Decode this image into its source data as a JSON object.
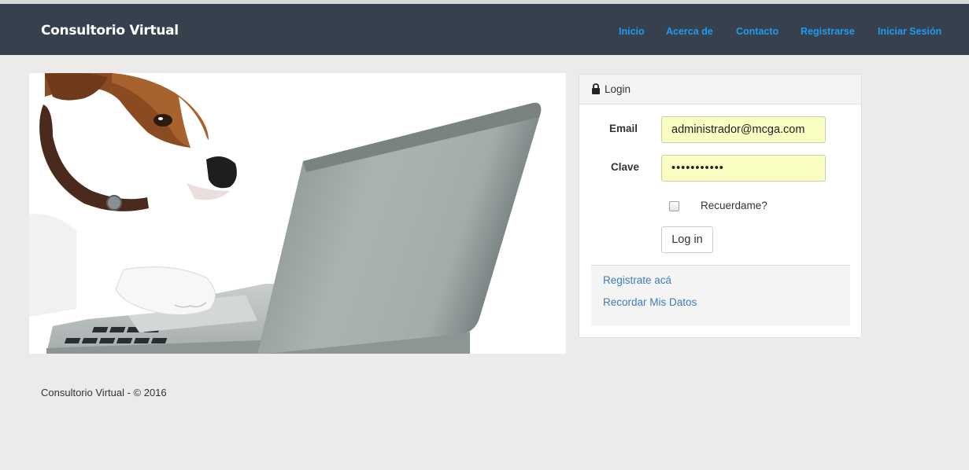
{
  "brand": "Consultorio Virtual",
  "nav": {
    "items": [
      "Inicio",
      "Acerca de",
      "Contacto",
      "Registrarse",
      "Iniciar Sesión"
    ]
  },
  "login": {
    "title": "Login",
    "email_label": "Email",
    "email_value": "administrador@mcga.com",
    "password_label": "Clave",
    "password_value": "•••••••••••",
    "remember_label": "Recuerdame?",
    "remember_checked": false,
    "submit_label": "Log in",
    "links": [
      "Registrate acá",
      "Recordar Mis Datos"
    ]
  },
  "footer": "Consultorio Virtual - © 2016",
  "colors": {
    "navbar": "#37404d",
    "nav_link": "#1e9bf0",
    "input_autofill": "#fafec3",
    "link": "#3e7cb9",
    "page_bg": "#edeaea"
  },
  "icons": [
    "lock-icon"
  ],
  "hero_image": "dog-using-laptop-photo"
}
